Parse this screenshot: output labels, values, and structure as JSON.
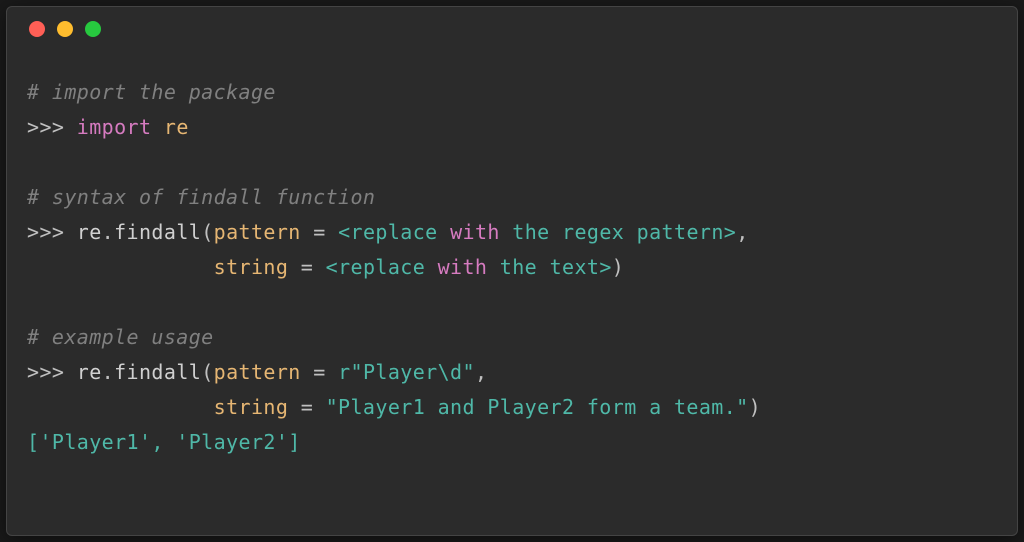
{
  "titlebar": {
    "dots": [
      "red",
      "yellow",
      "green"
    ]
  },
  "code": {
    "comment1": "# import the package",
    "prompt": ">>> ",
    "kw_import": "import",
    "module_re": "re",
    "comment2": "# syntax of findall function",
    "func_re": "re",
    "func_findall": "findall",
    "param_pattern": "pattern",
    "param_string": "string",
    "eq": " = ",
    "lt": "<",
    "gt": ">",
    "repl1_a": "replace ",
    "repl1_b": "with",
    "repl1_c": " the regex pattern",
    "repl2_a": "replace ",
    "repl2_b": "with",
    "repl2_c": " the text",
    "comment3": "# example usage",
    "str_pattern": "r\"Player\\d\"",
    "str_text": "\"Player1 and Player2 form a team.\"",
    "indent2": "               ",
    "result": "['Player1', 'Player2']",
    "comma": ",",
    "lparen": "(",
    "rparen": ")",
    "dot": ".",
    "space": " "
  }
}
